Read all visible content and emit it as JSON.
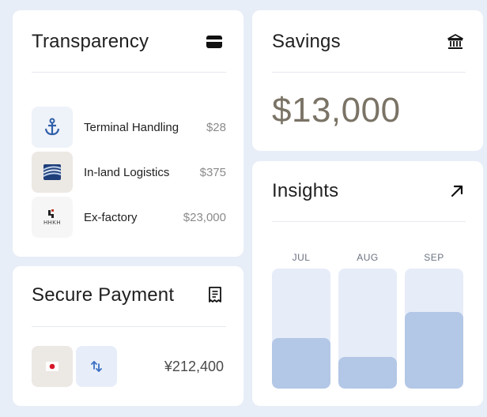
{
  "transparency": {
    "title": "Transparency",
    "icon": "card-icon",
    "items": [
      {
        "label": "Terminal Handling",
        "value": "$28",
        "icon": "anchor-icon"
      },
      {
        "label": "In-land Logistics",
        "value": "$375",
        "icon": "logistics-logo-icon"
      },
      {
        "label": "Ex-factory",
        "value": "$23,000",
        "icon": "factory-logo-icon",
        "logo_text": "HHKH"
      }
    ]
  },
  "savings": {
    "title": "Savings",
    "icon": "bank-icon",
    "amount": "$13,000"
  },
  "insights": {
    "title": "Insights",
    "icon": "arrow-up-right-icon"
  },
  "chart_data": {
    "type": "bar",
    "categories": [
      "JUL",
      "AUG",
      "SEP"
    ],
    "values": [
      0.42,
      0.26,
      0.64
    ],
    "ylim": [
      0,
      1
    ],
    "grid": false
  },
  "payment": {
    "title": "Secure Payment",
    "icon": "receipt-icon",
    "amount": "¥212,400",
    "flag_icon": "japan-flag-icon",
    "swap_icon": "swap-arrows-icon"
  },
  "colors": {
    "background": "#e8eef7",
    "card": "#ffffff",
    "bar_track": "#e6edf8",
    "bar_fill": "#b3c7e6",
    "accent_blue": "#2f5fa8",
    "amount": "#7a7366"
  }
}
